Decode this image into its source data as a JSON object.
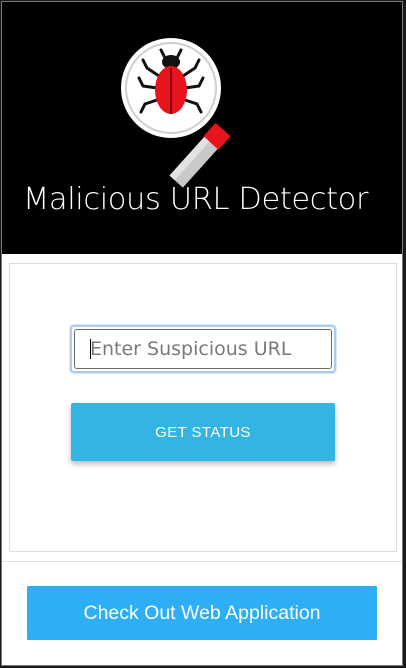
{
  "header": {
    "title": "Malicious URL Detector",
    "logo_icon": "bug-magnifier-icon"
  },
  "form": {
    "url_placeholder": "Enter Suspicious URL",
    "url_value": "",
    "submit_label": "GET STATUS"
  },
  "footer": {
    "webapp_button_label": "Check Out Web Application"
  },
  "colors": {
    "header_bg": "#000000",
    "status_button": "#33b4e3",
    "webapp_button": "#2eaef5",
    "bug_red": "#e8141c"
  }
}
